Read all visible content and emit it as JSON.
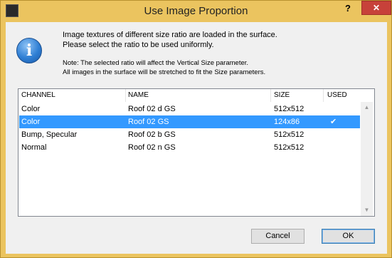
{
  "window": {
    "title": "Use Image Proportion",
    "help_label": "?",
    "close_label": "✕"
  },
  "message": {
    "line1": "Image textures of different size ratio are loaded in the surface.",
    "line2": "Please select the ratio to be used uniformly.",
    "note1": "Note: The selected ratio will affect the Vertical Size parameter.",
    "note2": "All images in the surface will be stretched to fit the Size parameters."
  },
  "table": {
    "columns": [
      "CHANNEL",
      "NAME",
      "SIZE",
      "USED"
    ],
    "rows": [
      {
        "channel": "Color",
        "name": "Roof 02 d GS",
        "size": "512x512",
        "used": ""
      },
      {
        "channel": "Color",
        "name": "Roof 02 GS",
        "size": "124x86",
        "used": "✔"
      },
      {
        "channel": "Bump, Specular",
        "name": "Roof 02 b GS",
        "size": "512x512",
        "used": ""
      },
      {
        "channel": "Normal",
        "name": "Roof 02 n GS",
        "size": "512x512",
        "used": ""
      }
    ],
    "selected_row": 1
  },
  "buttons": {
    "cancel": "Cancel",
    "ok": "OK"
  },
  "icons": {
    "app": "archicad-app-icon",
    "info": "info-icon",
    "info_glyph": "i",
    "scroll_up": "▲",
    "scroll_down": "▼"
  },
  "colors": {
    "titlebar": "#ebc45f",
    "close": "#c7413a",
    "selection": "#3399ff"
  }
}
